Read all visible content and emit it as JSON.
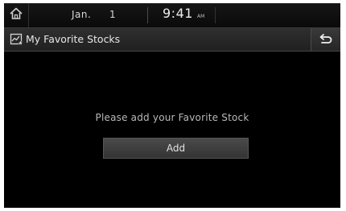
{
  "status_bar": {
    "month": "Jan.",
    "day": "1",
    "time": "9:41",
    "ampm": "AM"
  },
  "title_bar": {
    "title": "My Favorite Stocks"
  },
  "main": {
    "message": "Please add your Favorite Stock",
    "add_label": "Add"
  },
  "colors": {
    "background": "#000000",
    "text": "#b9b9b9",
    "button": "#404040"
  },
  "icons": {
    "home": "home-icon",
    "title": "stock-chart-star-icon",
    "back": "back-arrow-icon"
  }
}
